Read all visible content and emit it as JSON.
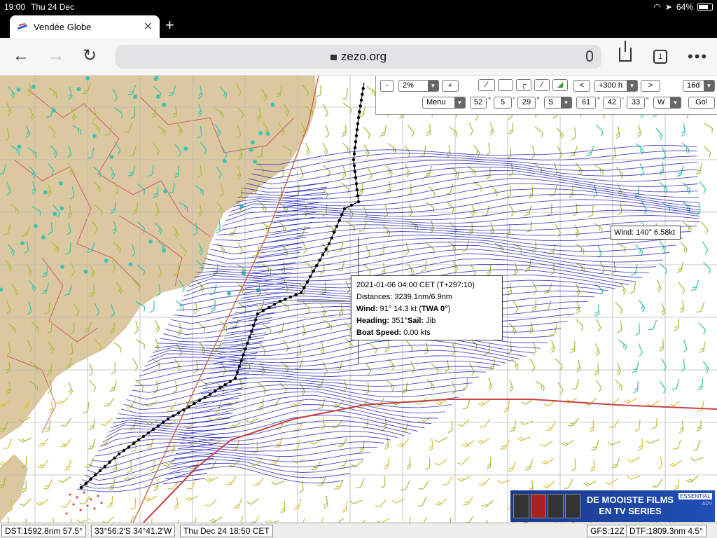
{
  "status": {
    "time": "19:00",
    "date": "Thu 24 Dec",
    "battery": "64%"
  },
  "browser": {
    "tab_title": "Vendée Globe",
    "url": "zezo.org",
    "tab_count": "1"
  },
  "toolbar": {
    "zoom_out": "-",
    "zoom_value": "2%",
    "zoom_in": "+",
    "prev": "<",
    "time_offset": "+300 h",
    "next": ">",
    "forecast_days": "16d",
    "menu": "Menu",
    "lat_deg": "52",
    "lat_min": "5",
    "lat_sec": "29",
    "lat_hemi": "S",
    "lon_deg": "61",
    "lon_min": "42",
    "lon_sec": "33",
    "lon_hemi": "W",
    "go": "Go!",
    "deg_sym": "°",
    "min_sym": "'",
    "sec_sym": "\""
  },
  "tooltip": {
    "datetime": "2021-01-06 04:00 CET (T+297:10)",
    "distances": "Distances: 3239.1nm/6.9nm",
    "wind_label": "Wind:",
    "wind_value": "91° 14.3 kt (",
    "twa": "TWA 0°",
    "wind_close": ")",
    "heading_label": "Heading:",
    "heading_value": "351°",
    "sail_label": "Sail:",
    "sail_value": "Jib",
    "speed_label": "Boat Speed:",
    "speed_value": "0.00 kts"
  },
  "wind_tip": "Wind: 140° 6.58kt",
  "ad": {
    "line1": "DE MOOISTE FILMS",
    "line2": "EN TV SERIES",
    "tag": "ESSENTIAL",
    "disclaimer": "ADV"
  },
  "bottom": {
    "dst": "DST:1592.8nm  57.5°",
    "position": "33°56.2'S  34°41.2'W",
    "time": "Thu Dec 24 18:50 CET",
    "gfs": "GFS:12Z",
    "dtf": "DTF:1809.3nm   4.5°"
  },
  "colors": {
    "land": "#dcc8a0",
    "route": "#000000",
    "isochrone": "#2a2ab8",
    "wind_light": "#3cc6b0",
    "wind_moderate": "#a8c03c",
    "wind_fresh": "#d8c03c",
    "ice_limit": "#c84040"
  }
}
